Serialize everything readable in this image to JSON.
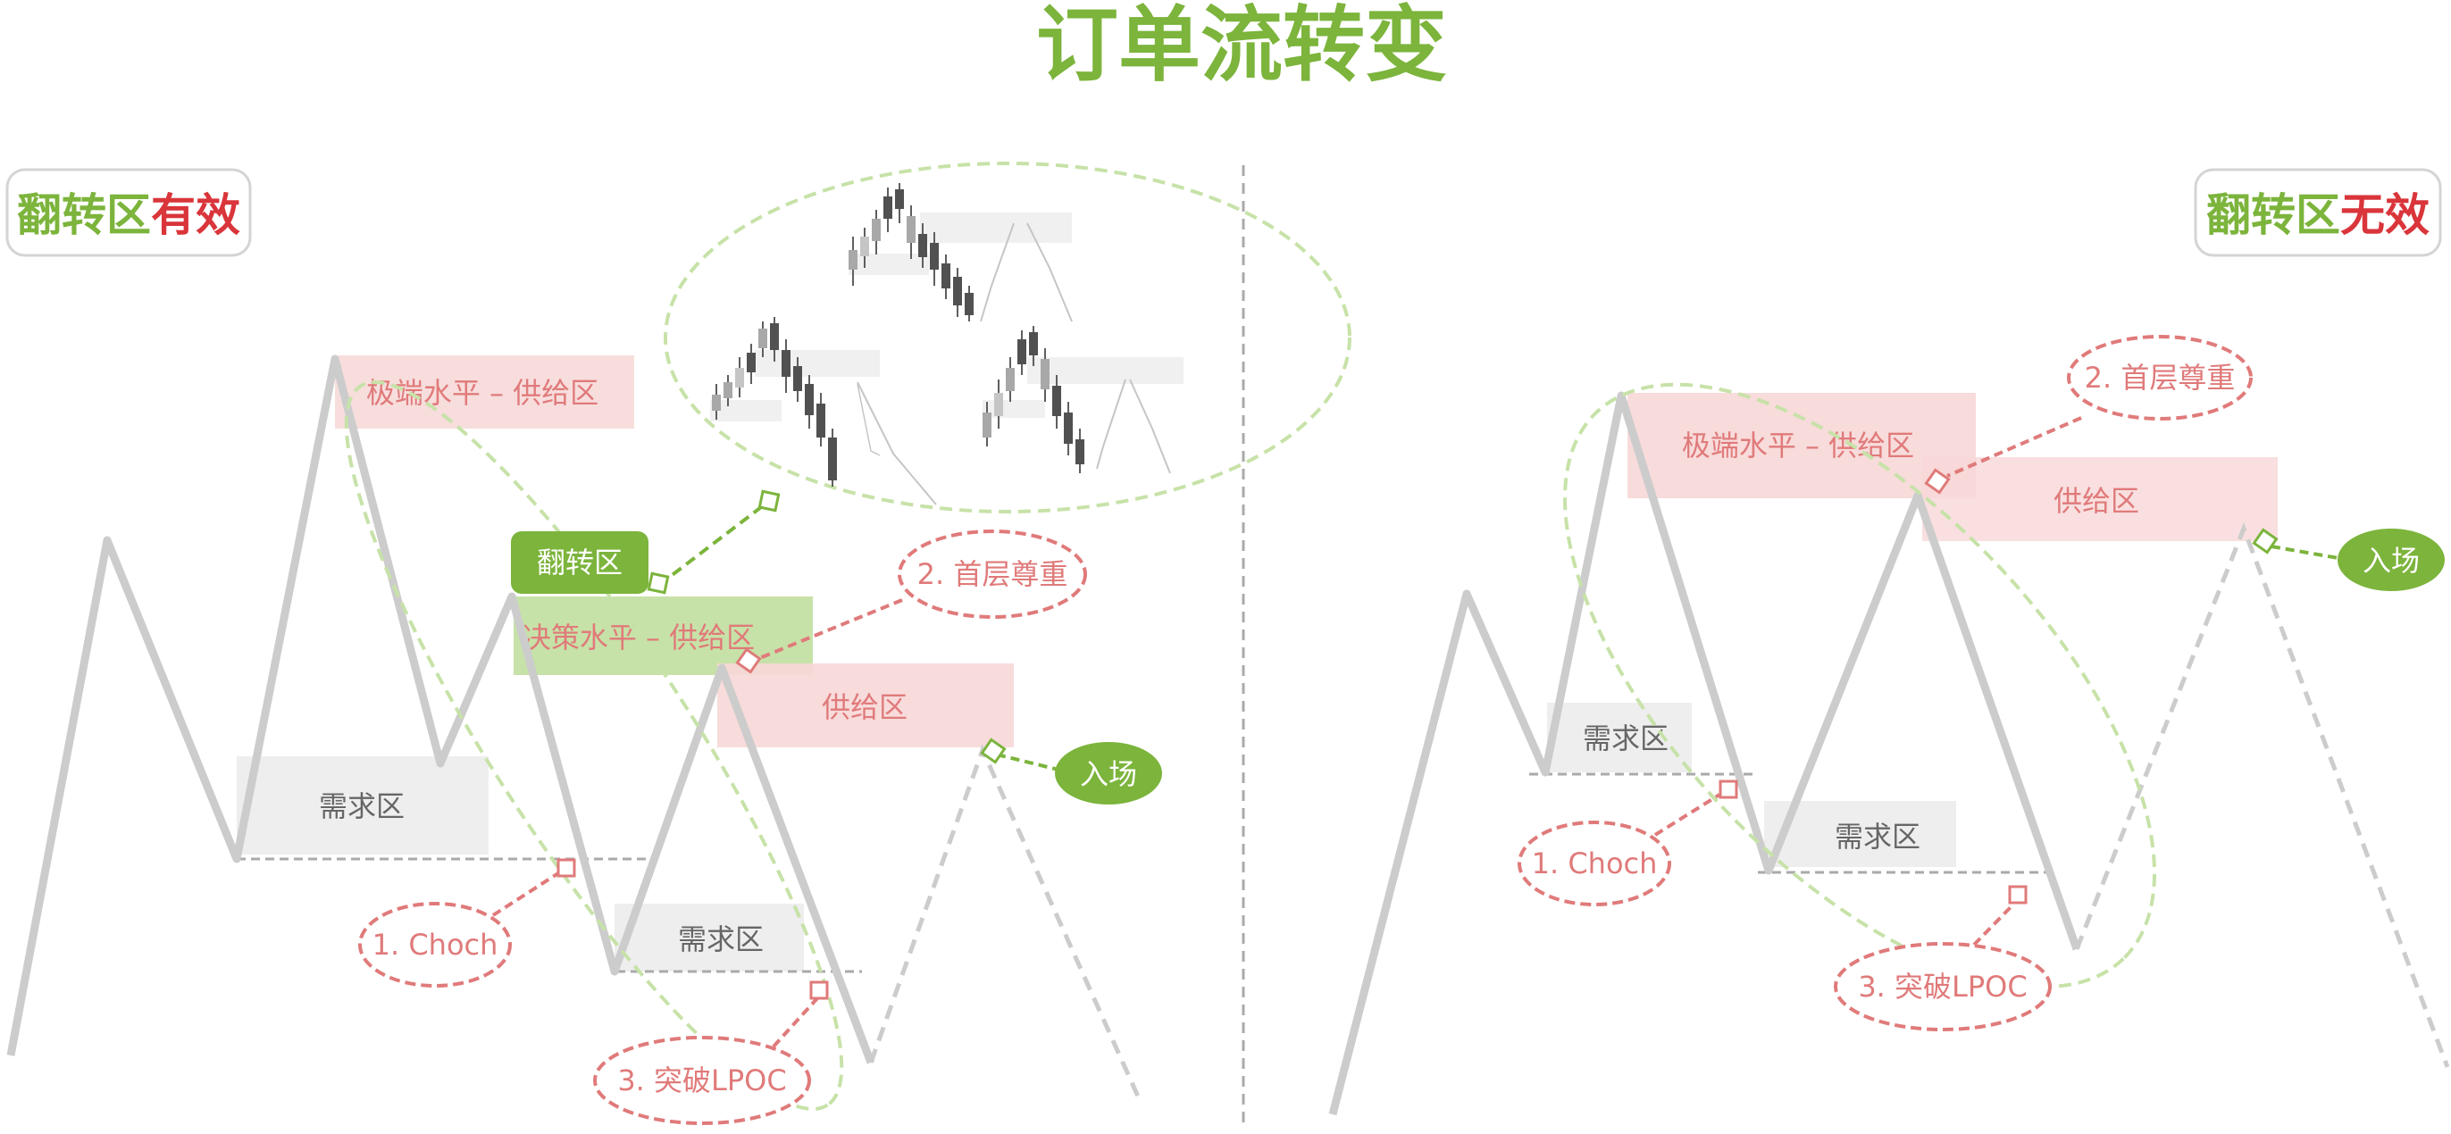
{
  "title": "订单流转变",
  "colors": {
    "green": "#7cb43c",
    "red": "#d9353a",
    "pink_text": "#e07a7a",
    "pink_fill": "#f7d7d7",
    "gray_line": "#cccccc",
    "gray_box": "#eeeeee",
    "gray_text": "#666666",
    "green_fill": "#c7e2a8"
  },
  "left_panel": {
    "badge_part1": "翻转区",
    "badge_part2": "有效",
    "extreme_supply": "极端水平 – 供给区",
    "flip_tag": "翻转区",
    "decision_supply": "决策水平 – 供给区",
    "supply": "供给区",
    "demand_upper": "需求区",
    "demand_lower": "需求区",
    "step1": "1. Choch",
    "step2": "2. 首层尊重",
    "step3": "3. 突破LPOC",
    "entry": "入场",
    "inset_icon": "candlestick-chart-thumbnails"
  },
  "right_panel": {
    "badge_part1": "翻转区",
    "badge_part2": "无效",
    "extreme_supply": "极端水平 – 供给区",
    "supply": "供给区",
    "demand_upper": "需求区",
    "demand_lower": "需求区",
    "step1": "1. Choch",
    "step2": "2. 首层尊重",
    "step3": "3. 突破LPOC",
    "entry": "入场"
  }
}
